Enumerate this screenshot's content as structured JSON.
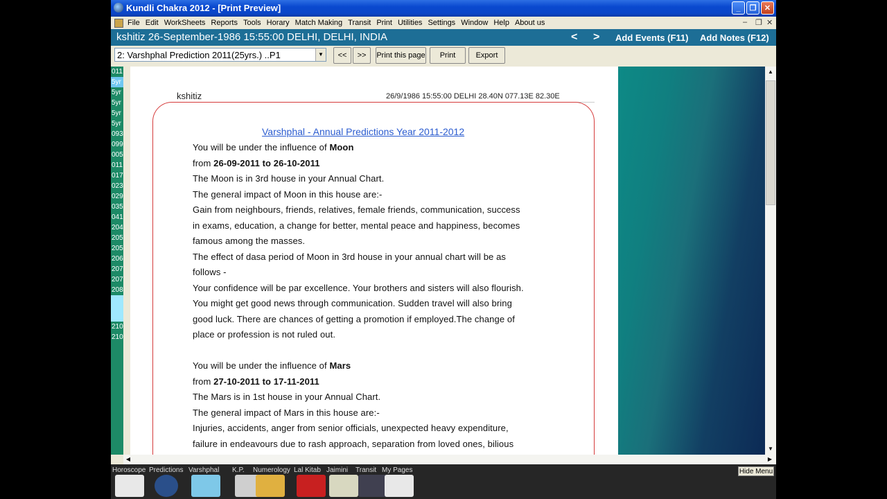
{
  "window": {
    "title": "Kundli Chakra 2012 - [Print Preview]",
    "controls": {
      "minimize": "_",
      "restore": "❐",
      "close": "✕"
    }
  },
  "menu": {
    "items": [
      "File",
      "Edit",
      "WorkSheets",
      "Reports",
      "Tools",
      "Horary",
      "Match Making",
      "Transit",
      "Print",
      "Utilities",
      "Settings",
      "Window",
      "Help",
      "About us"
    ],
    "mdi": {
      "minimize": "–",
      "restore": "❐",
      "close": "✕"
    }
  },
  "infobar": {
    "text": "kshitiz  26-September-1986  15:55:00  DELHI, DELHI, INDIA",
    "prev": "<",
    "next": ">",
    "add_events": "Add Events (F11)",
    "add_notes": "Add Notes (F12)"
  },
  "toolbar": {
    "select_value": "2: Varshphal Prediction 2011(25yrs.) ..P1",
    "prev_page": "<<",
    "next_page": ">>",
    "print_page": "Print this page",
    "print": "Print",
    "export": "Export"
  },
  "left_list": [
    "011",
    "5yr",
    "5yr",
    "5yr",
    "5yr",
    "5yr",
    "093",
    "099",
    "005",
    "011",
    "017",
    "023",
    "029",
    "035",
    "041",
    "204",
    "205",
    "205",
    "206",
    "207",
    "207",
    "208",
    "",
    "",
    "210",
    "210"
  ],
  "document": {
    "header_left": "kshitiz",
    "header_right": "26/9/1986  15:55:00 DELHI 28.40N 077.13E 82.30E",
    "heading": "Varshphal - Annual Predictions  Year 2011-2012",
    "lines": [
      {
        "text": "You will be under the influence of ",
        "bold": "Moon"
      },
      {
        "text": "from  ",
        "bold": "26-09-2011  to  26-10-2011"
      },
      {
        "text": "The Moon is in 3rd  house in your Annual Chart.",
        "bold": ""
      },
      {
        "text": "The general impact of Moon in this house are:-",
        "bold": ""
      },
      {
        "text": "Gain from neighbours, friends, relatives, female friends, communication, success",
        "bold": ""
      },
      {
        "text": "in exams, education, a change for better, mental peace and happiness, becomes",
        "bold": ""
      },
      {
        "text": "famous among the masses.",
        "bold": ""
      },
      {
        "text": "The effect of dasa period of Moon in 3rd house in your annual chart will be as",
        "bold": ""
      },
      {
        "text": "follows -",
        "bold": ""
      },
      {
        "text": "Your confidence will be par excellence. Your brothers and sisters will also flourish.",
        "bold": ""
      },
      {
        "text": "You might get good news through communication. Sudden travel will also bring",
        "bold": ""
      },
      {
        "text": "good luck. There are chances of getting a promotion if employed.The change of",
        "bold": ""
      },
      {
        "text": "place or profession is not ruled out.",
        "bold": ""
      },
      {
        "text": "",
        "bold": ""
      },
      {
        "text": "You will be under the influence of ",
        "bold": "Mars"
      },
      {
        "text": "from  ",
        "bold": "27-10-2011  to  17-11-2011"
      },
      {
        "text": "The Mars is in 1st  house in your Annual Chart.",
        "bold": ""
      },
      {
        "text": "The general impact of Mars in this house are:-",
        "bold": ""
      },
      {
        "text": "Injuries, accidents, anger from senior officials, unexpected heavy expenditure,",
        "bold": ""
      },
      {
        "text": "failure in endeavours due to rash approach, separation from loved ones, bilious",
        "bold": ""
      }
    ]
  },
  "bottom_tabs": [
    {
      "label": "Horoscope",
      "icon": "horoscope-chart-icon",
      "color": "#e8e8e8"
    },
    {
      "label": "Predictions",
      "icon": "predictions-wheel-icon",
      "color": "#2a4f8a"
    },
    {
      "label": "Varshphal",
      "icon": "varshphal-calendar-icon",
      "color": "#7ec8e8"
    },
    {
      "label": "K.P.",
      "icon": "kp-astrologer-icon",
      "color": "#cfcfcf"
    },
    {
      "label": "Numerology",
      "icon": "numerology-numbers-icon",
      "color": "#e0b040"
    },
    {
      "label": "Lal Kitab",
      "icon": "lal-kitab-book-icon",
      "color": "#c82020"
    },
    {
      "label": "Jaimini",
      "icon": "jaimini-icon",
      "color": "#d8d8c0"
    },
    {
      "label": "Transit",
      "icon": "transit-planets-icon",
      "color": "#404050"
    },
    {
      "label": "My Pages",
      "icon": "my-pages-icon",
      "color": "#e8e8e8"
    }
  ],
  "hide_menu": "Hide Menu",
  "colors": {
    "accent": "#1d6e96",
    "title_bar": "#0a49cf",
    "heading_link": "#2b5cd0",
    "page_border": "#d53a3a"
  }
}
